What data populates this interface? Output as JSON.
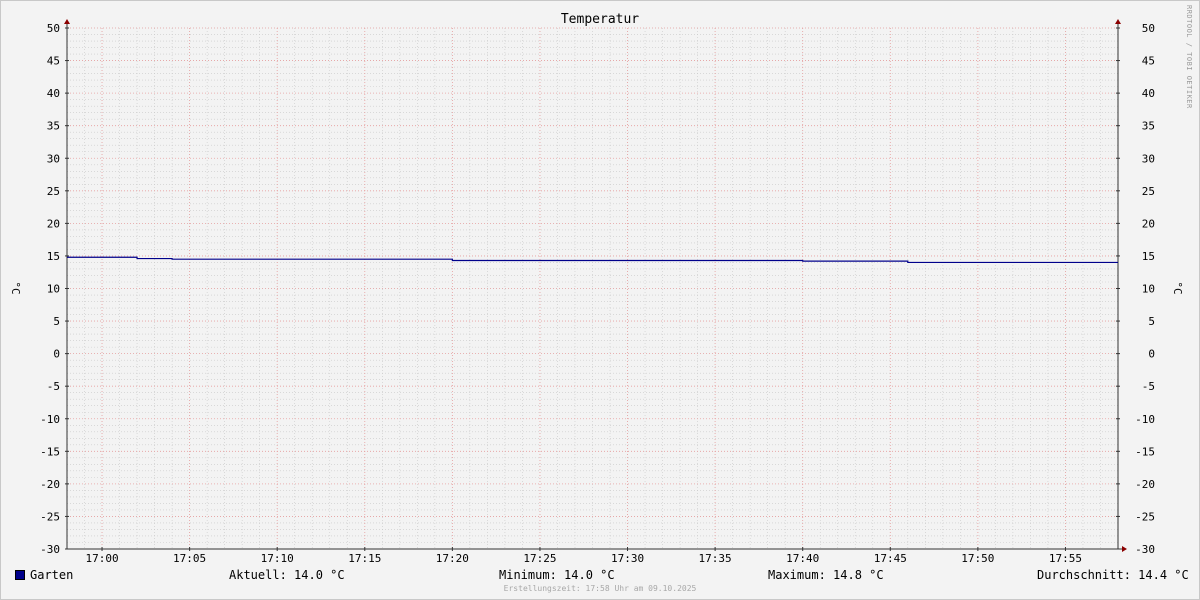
{
  "chart_data": {
    "type": "line",
    "title": "Temperatur",
    "ylabel": "°C",
    "ylabel_right": "°C",
    "ylim": [
      -30,
      50
    ],
    "y_ticks": [
      50,
      45,
      40,
      35,
      30,
      25,
      20,
      15,
      10,
      5,
      0,
      -5,
      -10,
      -15,
      -20,
      -25,
      -30
    ],
    "x_ticks": [
      "17:00",
      "17:05",
      "17:10",
      "17:15",
      "17:20",
      "17:25",
      "17:30",
      "17:35",
      "17:40",
      "17:45",
      "17:50",
      "17:55"
    ],
    "xlim": [
      "16:58",
      "17:58"
    ],
    "grid": true,
    "series": [
      {
        "name": "Garten",
        "color": "#00008b",
        "points": [
          {
            "t": "16:58",
            "v": 14.8
          },
          {
            "t": "17:02",
            "v": 14.6
          },
          {
            "t": "17:04",
            "v": 14.5
          },
          {
            "t": "17:20",
            "v": 14.3
          },
          {
            "t": "17:40",
            "v": 14.2
          },
          {
            "t": "17:46",
            "v": 14.0
          },
          {
            "t": "17:58",
            "v": 14.0
          }
        ]
      }
    ]
  },
  "side_text": "RRDTOOL / TOBI OETIKER",
  "legend": {
    "series_name": "Garten",
    "aktuell": "Aktuell: 14.0 °C",
    "minimum": "Minimum: 14.0 °C",
    "maximum": "Maximum: 14.8 °C",
    "durchschnitt": "Durchschnitt: 14.4 °C"
  },
  "footer": "Erstellungszeit: 17:58 Uhr am 09.10.2025",
  "colors": {
    "series": "#00008b",
    "major_grid": "#e8a0a0",
    "minor_grid": "#c8c8c8",
    "axis": "#333333",
    "arrow": "#8b0000"
  }
}
